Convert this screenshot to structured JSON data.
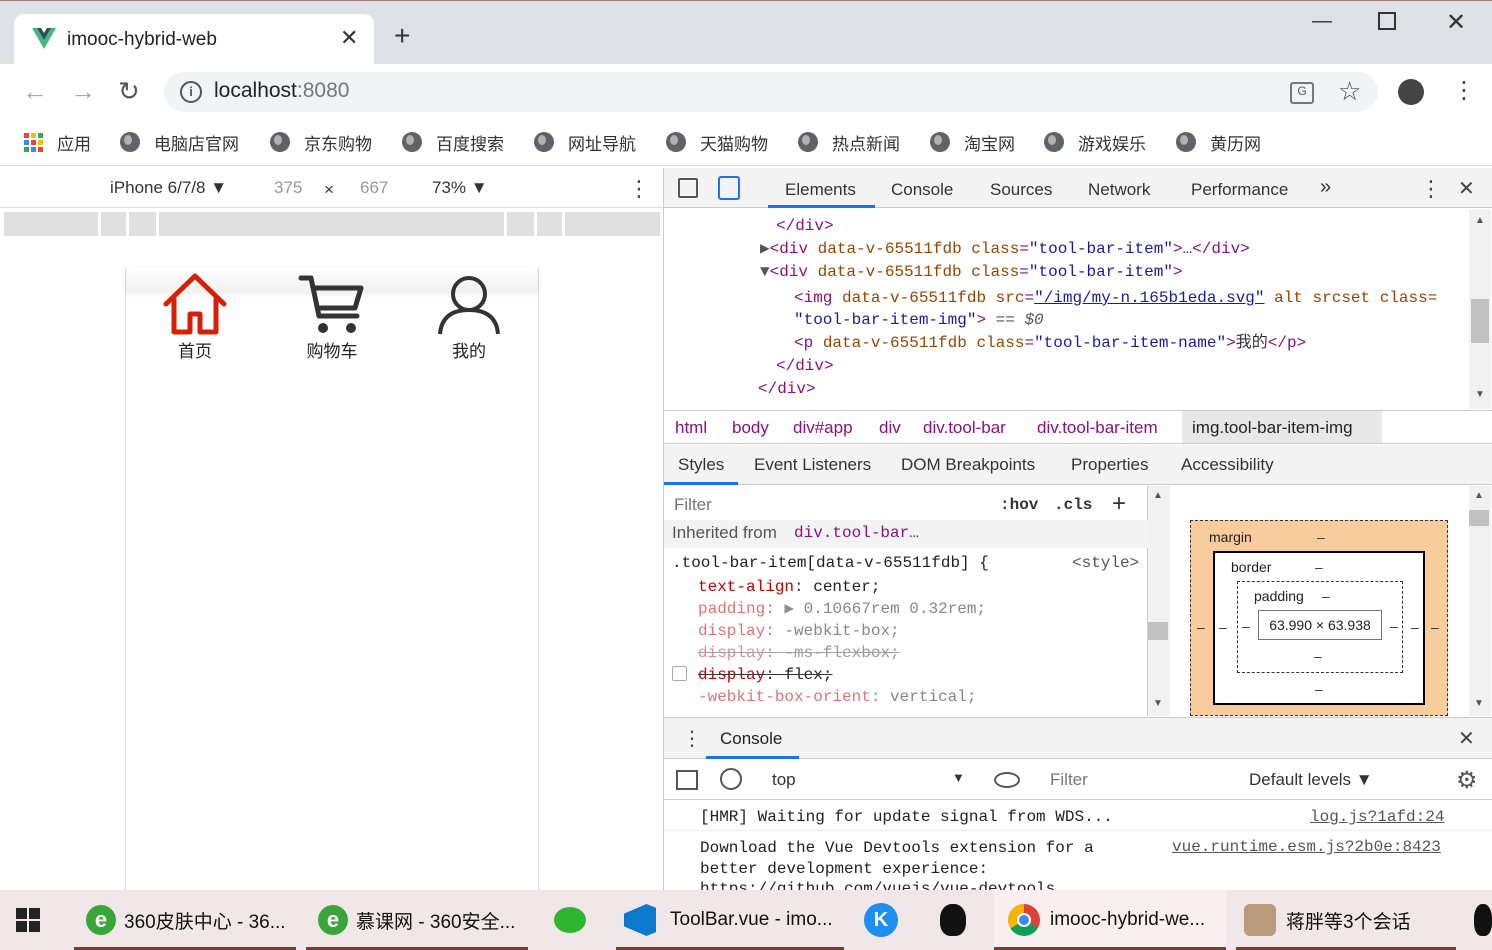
{
  "browser": {
    "tab_title": "imooc-hybrid-web",
    "url_host": "localhost",
    "url_port": ":8080",
    "bookmarks": [
      "应用",
      "电脑店官网",
      "京东购物",
      "百度搜索",
      "网址导航",
      "天猫购物",
      "热点新闻",
      "淘宝网",
      "游戏娱乐",
      "黄历网"
    ]
  },
  "device": {
    "model": "iPhone 6/7/8",
    "width": "375",
    "times": "×",
    "height": "667",
    "zoom": "73%"
  },
  "app": {
    "toolbar": [
      "首页",
      "购物车",
      "我的"
    ]
  },
  "devtools": {
    "tabs": [
      "Elements",
      "Console",
      "Sources",
      "Network",
      "Performance"
    ],
    "more": "»",
    "dom": {
      "l1_close_div": "</div>",
      "l2_attr": "data-v-65511fdb",
      "l2_class_attr": "class",
      "l2_class_val": "\"tool-bar-item\"",
      "l2_ellipsis": "…",
      "l4_src": "\"/img/my-n.165b1eda.svg\"",
      "l4_rest": " alt srcset class=",
      "l5_class": "\"tool-bar-item-img\"",
      "l5_eq": " == $0",
      "l6_class": "\"tool-bar-item-name\"",
      "l6_text": "我的"
    },
    "breadcrumbs": [
      "html",
      "body",
      "div#app",
      "div",
      "div.tool-bar",
      "div.tool-bar-item",
      "img.tool-bar-item-img"
    ],
    "subtabs": [
      "Styles",
      "Event Listeners",
      "DOM Breakpoints",
      "Properties",
      "Accessibility"
    ],
    "styles": {
      "filter_placeholder": "Filter",
      "hov": ":hov",
      "cls": ".cls",
      "inherited_label": "Inherited from",
      "inherited_from": "div.tool-bar…",
      "selector": ".tool-bar-item[data-v-65511fdb] {",
      "source": "<style>",
      "props": [
        {
          "name": "text-align",
          "value": "center;"
        },
        {
          "name": "padding",
          "value": "0.10667rem 0.32rem;"
        },
        {
          "name": "display",
          "value": "-webkit-box;"
        },
        {
          "name": "display",
          "value": "-ms-flexbox;"
        },
        {
          "name": "display",
          "value": "flex;"
        },
        {
          "name": "-webkit-box-orient",
          "value": "vertical;"
        }
      ]
    },
    "boxmodel": {
      "margin": "margin",
      "border": "border",
      "padding": "padding",
      "dash": "–",
      "content": "63.990 × 63.938"
    },
    "console": {
      "title": "Console",
      "context": "top",
      "filter_placeholder": "Filter",
      "levels": "Default levels",
      "messages": [
        {
          "text": "[HMR] Waiting for update signal from WDS...",
          "source": "log.js?1afd:24"
        },
        {
          "text": "Download the Vue Devtools extension for a better development experience:",
          "source": "vue.runtime.esm.js?2b0e:8423"
        },
        {
          "text": "https://github.com/vuejs/vue-devtools",
          "source": ""
        }
      ]
    }
  },
  "taskbar": {
    "items": [
      "360皮肤中心 - 36...",
      "慕课网 - 360安全...",
      "ToolBar.vue - imo...",
      "imooc-hybrid-we...",
      "蒋胖等3个会话"
    ]
  },
  "colors": {
    "accent_red": "#d81e06",
    "tag_purple": "#881280",
    "attr_brown": "#994500",
    "value_blue": "#1a1aa6",
    "devtools_blue": "#1a73e8",
    "margin_orange": "#f9cc9d"
  }
}
